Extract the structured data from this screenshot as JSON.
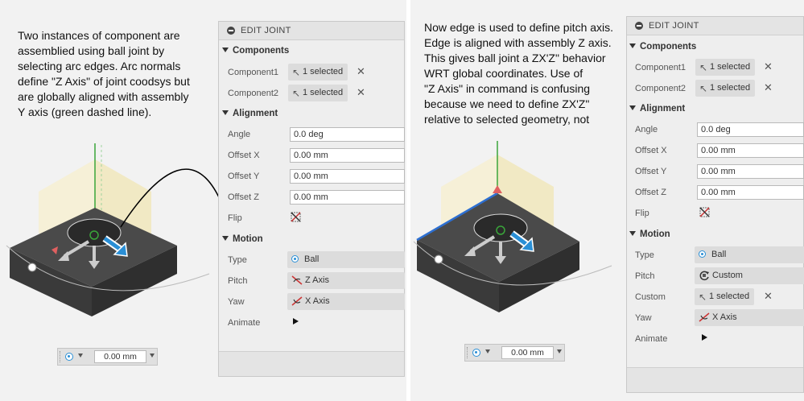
{
  "left": {
    "note_lines": [
      "Two instances of component are",
      "assemblied using ball joint by",
      "selecting arc edges. Arc normals",
      "define \"Z Axis\" of joint coodsys but",
      "are globally aligned with assembly",
      "Y axis (green dashed line)."
    ],
    "panel": {
      "title": "EDIT JOINT",
      "components_header": "Components",
      "component1_label": "Component1",
      "component1_value": "1 selected",
      "component2_label": "Component2",
      "component2_value": "1 selected",
      "alignment_header": "Alignment",
      "angle_label": "Angle",
      "angle_value": "0.0 deg",
      "offset_x_label": "Offset X",
      "offset_x_value": "0.00 mm",
      "offset_y_label": "Offset Y",
      "offset_y_value": "0.00 mm",
      "offset_z_label": "Offset Z",
      "offset_z_value": "0.00 mm",
      "flip_label": "Flip",
      "motion_header": "Motion",
      "type_label": "Type",
      "type_value": "Ball",
      "pitch_label": "Pitch",
      "pitch_value": "Z Axis",
      "yaw_label": "Yaw",
      "yaw_value": "X Axis",
      "animate_label": "Animate"
    },
    "toolbar_value": "0.00 mm"
  },
  "right": {
    "note_lines": [
      "Now edge is used to define pitch axis.",
      "Edge is aligned with assembly Z axis.",
      "This gives ball joint a ZX'Z\" behavior",
      "WRT global coordinates. Use of",
      "\"Z Axis\" in command is confusing",
      "because we need to define ZX'Z\"",
      "relative to selected geometry, not"
    ],
    "panel": {
      "title": "EDIT JOINT",
      "components_header": "Components",
      "component1_label": "Component1",
      "component1_value": "1 selected",
      "component2_label": "Component2",
      "component2_value": "1 selected",
      "alignment_header": "Alignment",
      "angle_label": "Angle",
      "angle_value": "0.0 deg",
      "offset_x_label": "Offset X",
      "offset_x_value": "0.00 mm",
      "offset_y_label": "Offset Y",
      "offset_y_value": "0.00 mm",
      "offset_z_label": "Offset Z",
      "offset_z_value": "0.00 mm",
      "flip_label": "Flip",
      "motion_header": "Motion",
      "type_label": "Type",
      "type_value": "Ball",
      "pitch_label": "Pitch",
      "pitch_value": "Custom",
      "custom_label": "Custom",
      "custom_value": "1 selected",
      "yaw_label": "Yaw",
      "yaw_value": "X Axis",
      "animate_label": "Animate"
    },
    "toolbar_value": "0.00 mm"
  },
  "icons": {
    "panel_header": "minus-circle-icon",
    "selection": "cursor-arrow-icon",
    "clear": "close-icon",
    "flip": "flip-icon",
    "ball": "radio-icon",
    "axis": "axis-icon",
    "custom": "custom-rotate-icon",
    "animate": "play-icon"
  },
  "colors": {
    "accent_blue": "#2a8fd6",
    "green_axis": "#3aa53a",
    "edge_blue": "#2d6fd1",
    "block_top": "#4a4a4a",
    "block_side": "#3a3a3a",
    "panel_bg": "#eeeeee"
  }
}
